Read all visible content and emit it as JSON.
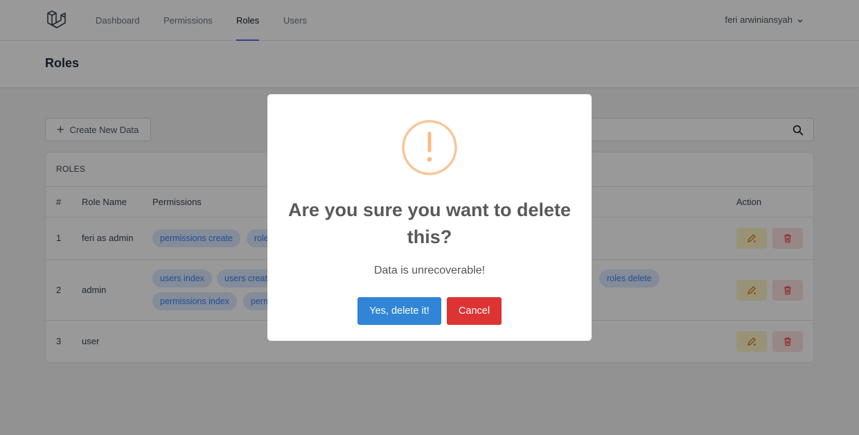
{
  "nav": {
    "links": [
      "Dashboard",
      "Permissions",
      "Roles",
      "Users"
    ],
    "active": "Roles",
    "user_name": "feri arwiniansyah"
  },
  "page": {
    "title": "Roles"
  },
  "toolbar": {
    "create_label": "Create New Data",
    "search_value": ""
  },
  "table": {
    "card_title": "ROLES",
    "headers": [
      "#",
      "Role Name",
      "Permissions",
      "Action"
    ],
    "rows": [
      {
        "no": "1",
        "name": "feri as admin",
        "permissions": [
          "permissions create",
          "role"
        ]
      },
      {
        "no": "2",
        "name": "admin",
        "permissions": [
          "users index",
          "users creat",
          "roles delete",
          "permissions index",
          "perm"
        ]
      },
      {
        "no": "3",
        "name": "user",
        "permissions": []
      }
    ]
  },
  "modal": {
    "icon": "exclamation-icon",
    "title": "Are you sure you want to delete this?",
    "text": "Data is unrecoverable!",
    "confirm_label": "Yes, delete it!",
    "cancel_label": "Cancel"
  },
  "colors": {
    "accent": "#6366f1",
    "badge_bg": "#dbeafe",
    "badge_text": "#3b82f6",
    "warning": "#f8bb86",
    "confirm": "#3085d6",
    "cancel": "#dd3333"
  }
}
